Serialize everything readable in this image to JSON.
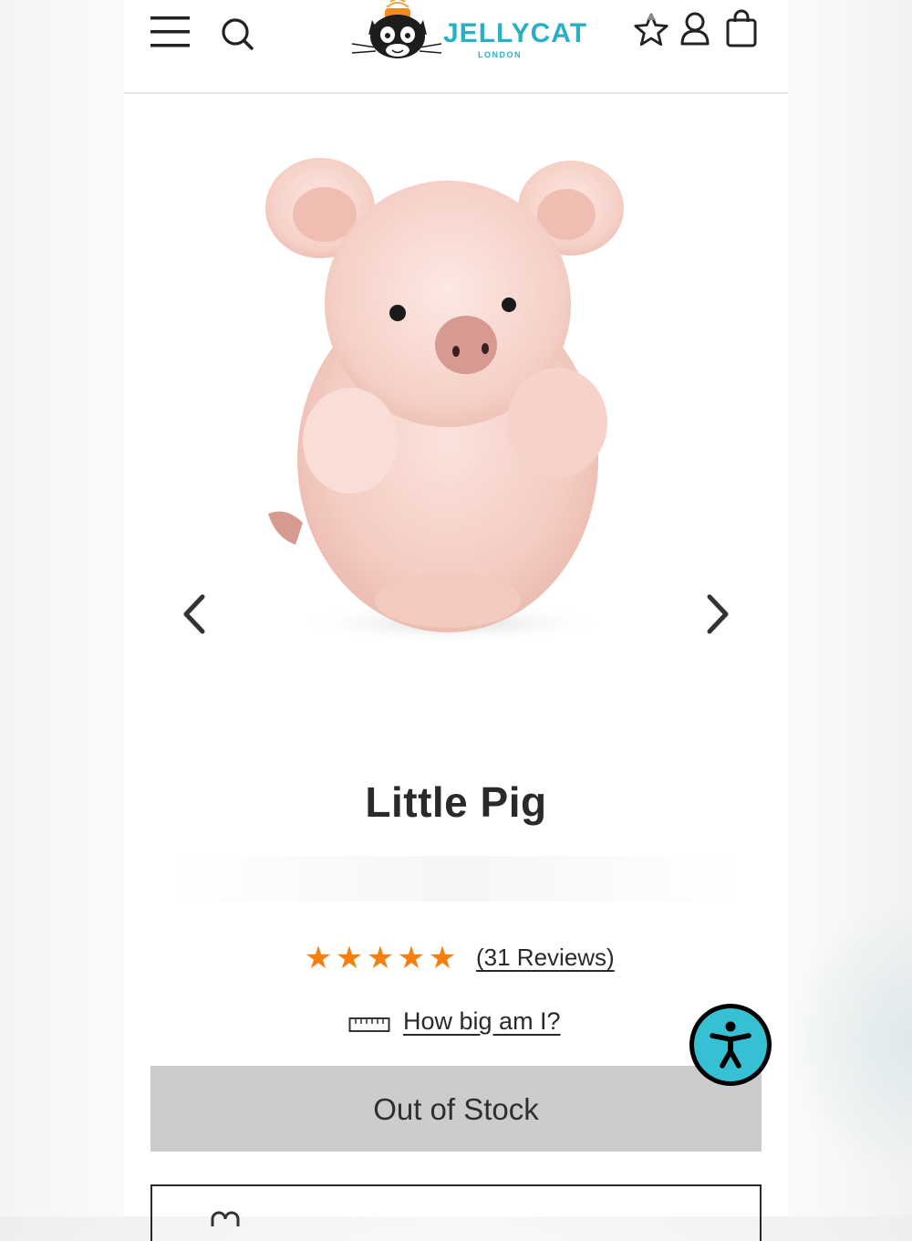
{
  "header": {
    "brand_name": "JELLYCAT",
    "brand_sub": "LONDON",
    "icons": [
      "menu-icon",
      "search-icon",
      "wishlist-icon",
      "account-icon",
      "bag-icon"
    ]
  },
  "gallery": {
    "image_alt": "Little Pig",
    "prev_icon": "chevron-left-icon",
    "next_icon": "chevron-right-icon"
  },
  "product": {
    "title": "Little Pig",
    "rating": 5,
    "rating_max": 5,
    "reviews_label": "(31 Reviews)",
    "size_link": "How big am I?",
    "button_label": "Out of Stock"
  },
  "colors": {
    "brand": "#2ab0c5",
    "star": "#f47f0c",
    "button_bg": "#cccccc",
    "accessibility": "#35c0d3"
  }
}
